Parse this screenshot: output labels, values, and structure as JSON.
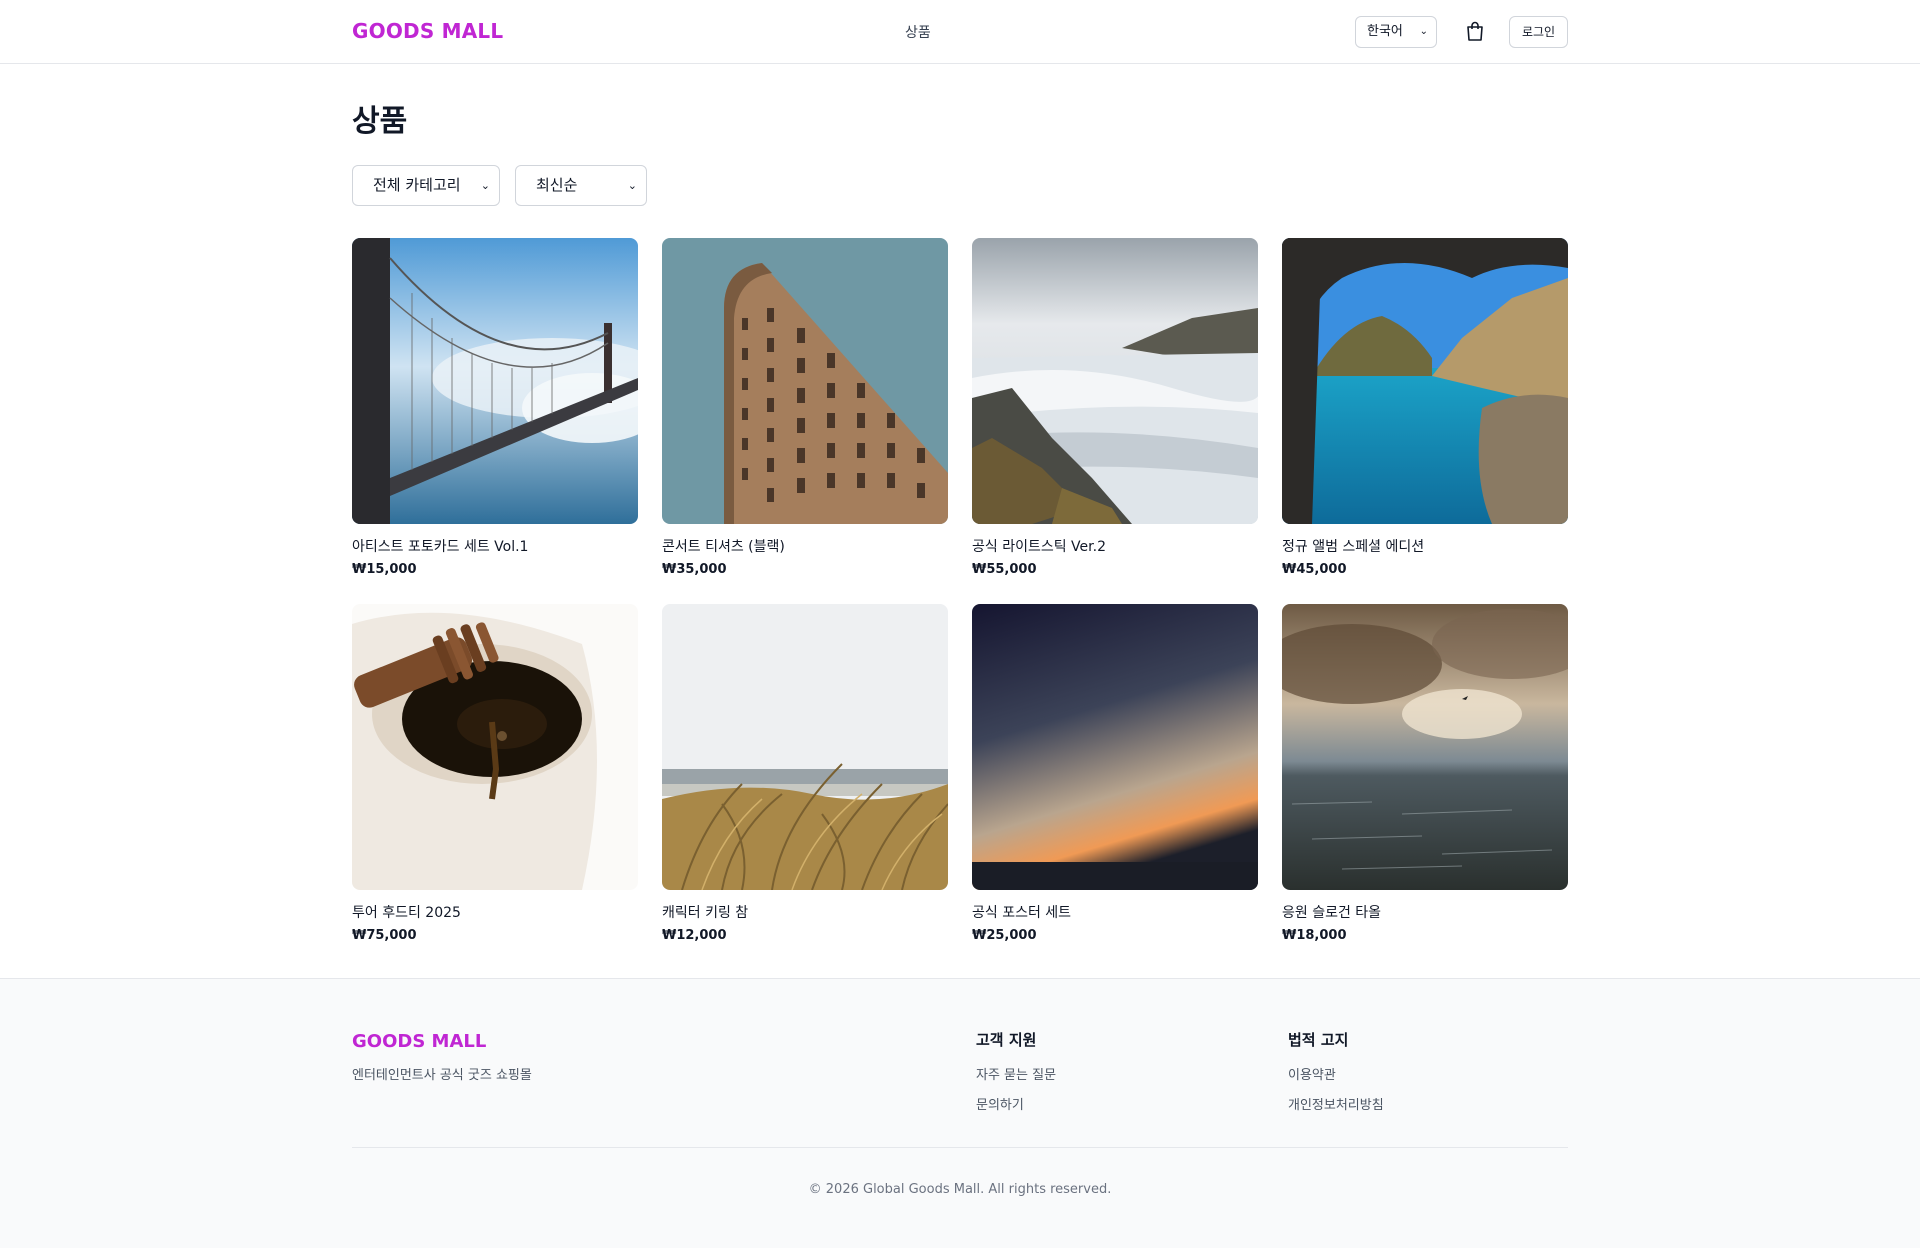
{
  "header": {
    "logo": "GOODS MALL",
    "nav_products": "상품",
    "language": "한국어",
    "cart_icon": "shopping-bag-icon",
    "login": "로그인"
  },
  "main": {
    "title": "상품",
    "category_filter": "전체 카테고리",
    "sort": "최신순"
  },
  "products": [
    {
      "name": "아티스트 포토카드 세트 Vol.1",
      "price": "₩15,000",
      "image": "golden-gate-bridge-fog"
    },
    {
      "name": "콘서트 티셔츠 (블랙)",
      "price": "₩35,000",
      "image": "flatiron-building"
    },
    {
      "name": "공식 라이트스틱 Ver.2",
      "price": "₩55,000",
      "image": "waterfall-cliffs"
    },
    {
      "name": "정규 앨범 스페셜 에디션",
      "price": "₩45,000",
      "image": "sea-cave-cove"
    },
    {
      "name": "투어 후드티 2025",
      "price": "₩75,000",
      "image": "honey-dipper-jar"
    },
    {
      "name": "캐릭터 키링 참",
      "price": "₩12,000",
      "image": "beach-dune-grass"
    },
    {
      "name": "공식 포스터 세트",
      "price": "₩25,000",
      "image": "sunset-horizon"
    },
    {
      "name": "응원 슬로건 타올",
      "price": "₩18,000",
      "image": "stormy-sea-sky"
    }
  ],
  "footer": {
    "logo": "GOODS MALL",
    "tagline": "엔터테인먼트사 공식 굿즈 쇼핑몰",
    "support_title": "고객 지원",
    "faq": "자주 묻는 질문",
    "contact": "문의하기",
    "legal_title": "법적 고지",
    "terms": "이용약관",
    "privacy": "개인정보처리방침",
    "copyright": "© 2026 Global Goods Mall. All rights reserved."
  },
  "colors": {
    "brand": "#c026d3",
    "text": "#111827",
    "muted": "#4b5563",
    "footer_bg": "#f9fafb",
    "border": "#e5e7eb"
  }
}
